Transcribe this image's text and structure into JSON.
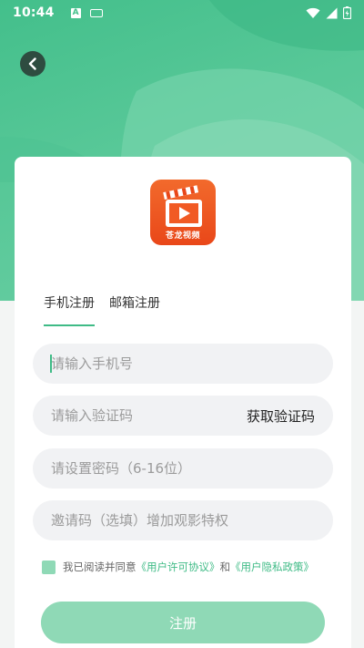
{
  "status_bar": {
    "time": "10:44",
    "notif_letter": "A"
  },
  "colors": {
    "brand": "#3fbb86",
    "header": "#50c493",
    "button": "#8fd9b6",
    "logo": "#ee5522"
  },
  "app": {
    "logo_label": "苍龙视频"
  },
  "tabs": [
    {
      "label": "手机注册",
      "active": true
    },
    {
      "label": "邮箱注册",
      "active": false
    }
  ],
  "form": {
    "phone_placeholder": "请输入手机号",
    "code_placeholder": "请输入验证码",
    "get_code_label": "获取验证码",
    "password_placeholder": "请设置密码（6-16位）",
    "invite_placeholder": "邀请码（选填）增加观影特权"
  },
  "agreement": {
    "prefix": "我已阅读并同意",
    "terms": "《用户许可协议》",
    "and": "和",
    "privacy": "《用户隐私政策》"
  },
  "submit_label": "注册"
}
